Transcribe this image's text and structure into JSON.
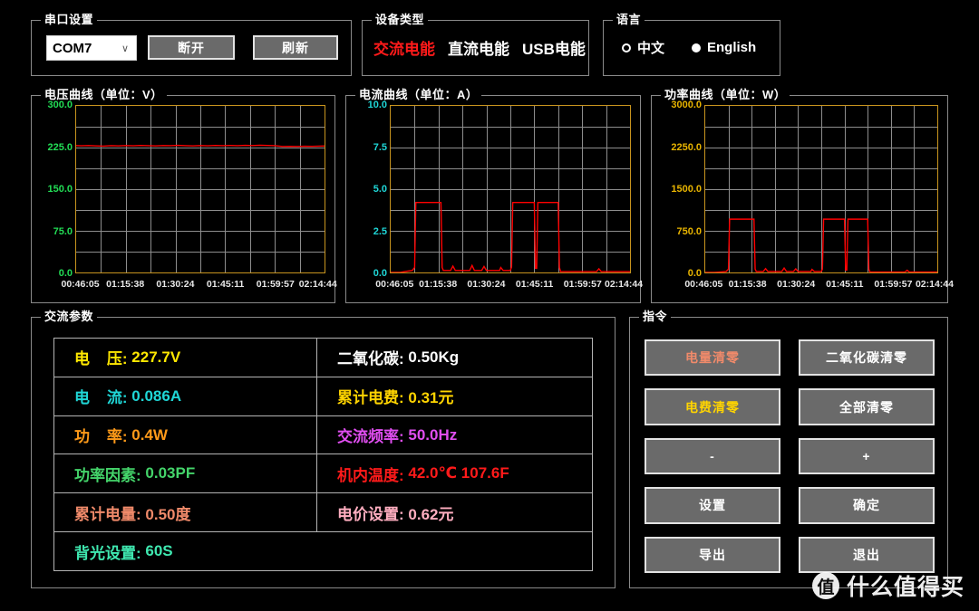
{
  "serial_panel": {
    "title": "串口设置",
    "port_value": "COM7",
    "chevron": "∨",
    "disconnect_label": "断开",
    "refresh_label": "刷新"
  },
  "device_panel": {
    "title": "设备类型",
    "types": [
      {
        "label": "交流电能",
        "selected": true,
        "color": "#ff1a1a"
      },
      {
        "label": "直流电能",
        "selected": false,
        "color": "#ffffff"
      },
      {
        "label": "USB电能",
        "selected": false,
        "color": "#ffffff"
      }
    ]
  },
  "language_panel": {
    "title": "语言",
    "options": [
      {
        "label": "中文",
        "selected": false
      },
      {
        "label": "English",
        "selected": true
      }
    ]
  },
  "charts": [
    {
      "title": "电压曲线（单位：V）",
      "tick_color": "#22dd55",
      "yticks": [
        "300.0",
        "225.0",
        "150.0",
        "75.0",
        "0.0"
      ]
    },
    {
      "title": "电流曲线（单位：A）",
      "tick_color": "#1fd6d6",
      "yticks": [
        "10.0",
        "7.5",
        "5.0",
        "2.5",
        "0.0"
      ]
    },
    {
      "title": "功率曲线（单位：W）",
      "tick_color": "#e8b400",
      "yticks": [
        "3000.0",
        "2250.0",
        "1500.0",
        "750.0",
        "0.0"
      ]
    }
  ],
  "xticks": [
    "00:46:05",
    "01:15:38",
    "01:30:24",
    "01:45:11",
    "01:59:57",
    "02:14:44"
  ],
  "params_panel": {
    "title": "交流参数",
    "rows": [
      [
        {
          "key": "电    压:",
          "value": "227.7V",
          "color": "#ffe800"
        },
        {
          "key": "二氧化碳:",
          "value": "0.50Kg",
          "color": "#ffffff"
        }
      ],
      [
        {
          "key": "电    流:",
          "value": "0.086A",
          "color": "#1fd6d6"
        },
        {
          "key": "累计电费:",
          "value": "0.31元",
          "color": "#ffd400"
        }
      ],
      [
        {
          "key": "功    率:",
          "value": "0.4W",
          "color": "#ff9a19"
        },
        {
          "key": "交流频率:",
          "value": "50.0Hz",
          "color": "#e04ef0"
        }
      ],
      [
        {
          "key": "功率因素:",
          "value": "0.03PF",
          "color": "#44d46a"
        },
        {
          "key": "机内温度:",
          "value": "42.0℃ 107.6F",
          "color": "#ff1a1a"
        }
      ],
      [
        {
          "key": "累计电量:",
          "value": "0.50度",
          "color": "#f08a6a"
        },
        {
          "key": "电价设置:",
          "value": "0.62元",
          "color": "#ffaec0"
        }
      ],
      [
        {
          "key": "背光设置:",
          "value": "60S",
          "color": "#3fe8b0"
        }
      ]
    ]
  },
  "command_panel": {
    "title": "指令",
    "buttons": [
      {
        "label": "电量清零",
        "color": "#f08a6a"
      },
      {
        "label": "二氧化碳清零",
        "color": "#ffffff"
      },
      {
        "label": "电费清零",
        "color": "#ffd400"
      },
      {
        "label": "全部清零",
        "color": "#ffffff"
      },
      {
        "label": "-",
        "color": "#ffffff"
      },
      {
        "label": "+",
        "color": "#ffffff"
      },
      {
        "label": "设置",
        "color": "#ffffff"
      },
      {
        "label": "确定",
        "color": "#ffffff"
      },
      {
        "label": "导出",
        "color": "#ffffff"
      },
      {
        "label": "退出",
        "color": "#ffffff"
      }
    ]
  },
  "watermark": {
    "badge": "值",
    "text": "什么值得买"
  },
  "chart_data": [
    {
      "type": "line",
      "title": "电压曲线（单位：V）",
      "xlabel": "",
      "ylabel": "V",
      "ylim": [
        0,
        300
      ],
      "yticks": [
        0,
        75,
        150,
        225,
        300
      ],
      "xtick_labels": [
        "00:46:05",
        "01:15:38",
        "01:30:24",
        "01:45:11",
        "01:59:57",
        "02:14:44"
      ],
      "grid": true,
      "line_color": "#ff0000",
      "series": [
        {
          "name": "电压",
          "x": [
            0,
            0.02,
            0.05,
            0.08,
            0.11,
            0.14,
            0.17,
            0.2,
            0.23,
            0.26,
            0.29,
            0.32,
            0.35,
            0.38,
            0.41,
            0.44,
            0.47,
            0.5,
            0.53,
            0.56,
            0.59,
            0.62,
            0.65,
            0.68,
            0.71,
            0.74,
            0.77,
            0.8,
            0.83,
            0.86,
            0.89,
            0.92,
            0.95,
            0.98,
            1.0
          ],
          "y": [
            228.5,
            228.2,
            228.6,
            228.0,
            227.6,
            228.4,
            228.0,
            228.6,
            228.2,
            228.8,
            228.4,
            228.0,
            228.6,
            228.3,
            228.9,
            228.4,
            228.0,
            228.5,
            228.2,
            228.7,
            228.3,
            228.8,
            228.4,
            229.0,
            228.6,
            229.2,
            228.8,
            228.4,
            226.9,
            227.2,
            227.0,
            227.4,
            227.1,
            227.5,
            227.7
          ]
        }
      ]
    },
    {
      "type": "line",
      "title": "电流曲线（单位：A）",
      "xlabel": "",
      "ylabel": "A",
      "ylim": [
        0,
        10
      ],
      "yticks": [
        0,
        2.5,
        5.0,
        7.5,
        10.0
      ],
      "xtick_labels": [
        "00:46:05",
        "01:15:38",
        "01:30:24",
        "01:45:11",
        "01:59:57",
        "02:14:44"
      ],
      "grid": true,
      "line_color": "#ff0000",
      "series": [
        {
          "name": "电流",
          "x": [
            0,
            0.04,
            0.07,
            0.09,
            0.1,
            0.105,
            0.11,
            0.12,
            0.21,
            0.215,
            0.22,
            0.25,
            0.26,
            0.27,
            0.28,
            0.33,
            0.34,
            0.35,
            0.38,
            0.39,
            0.4,
            0.455,
            0.46,
            0.47,
            0.5,
            0.505,
            0.51,
            0.515,
            0.52,
            0.6,
            0.605,
            0.61,
            0.615,
            0.62,
            0.625,
            0.63,
            0.7,
            0.705,
            0.71,
            0.8,
            0.86,
            0.87,
            0.88,
            1.0
          ],
          "y": [
            0.0,
            0.0,
            0.08,
            0.12,
            0.3,
            4.2,
            4.2,
            4.2,
            4.2,
            0.3,
            0.12,
            0.12,
            0.38,
            0.12,
            0.12,
            0.12,
            0.42,
            0.12,
            0.12,
            0.36,
            0.12,
            0.12,
            0.3,
            0.12,
            0.12,
            0.32,
            4.2,
            4.2,
            4.2,
            4.2,
            0.25,
            0.25,
            4.2,
            4.2,
            4.2,
            4.2,
            4.2,
            0.3,
            0.05,
            0.05,
            0.05,
            0.22,
            0.05,
            0.05
          ]
        }
      ]
    },
    {
      "type": "line",
      "title": "功率曲线（单位：W）",
      "xlabel": "",
      "ylabel": "W",
      "ylim": [
        0,
        3000
      ],
      "yticks": [
        0,
        750,
        1500,
        2250,
        3000
      ],
      "xtick_labels": [
        "00:46:05",
        "01:15:38",
        "01:30:24",
        "01:45:11",
        "01:59:57",
        "02:14:44"
      ],
      "grid": true,
      "line_color": "#ff0000",
      "series": [
        {
          "name": "功率",
          "x": [
            0,
            0.04,
            0.07,
            0.09,
            0.1,
            0.105,
            0.11,
            0.12,
            0.21,
            0.215,
            0.22,
            0.25,
            0.26,
            0.27,
            0.28,
            0.33,
            0.34,
            0.35,
            0.38,
            0.39,
            0.4,
            0.455,
            0.46,
            0.47,
            0.5,
            0.505,
            0.51,
            0.515,
            0.52,
            0.6,
            0.605,
            0.61,
            0.615,
            0.62,
            0.625,
            0.63,
            0.7,
            0.705,
            0.71,
            0.8,
            0.86,
            0.87,
            0.88,
            1.0
          ],
          "y": [
            0,
            0,
            10,
            18,
            60,
            960,
            960,
            960,
            960,
            60,
            18,
            18,
            70,
            18,
            18,
            18,
            80,
            18,
            18,
            66,
            18,
            18,
            55,
            18,
            18,
            60,
            960,
            960,
            960,
            960,
            45,
            45,
            960,
            960,
            960,
            960,
            960,
            60,
            6,
            6,
            6,
            40,
            6,
            6
          ]
        }
      ]
    }
  ]
}
